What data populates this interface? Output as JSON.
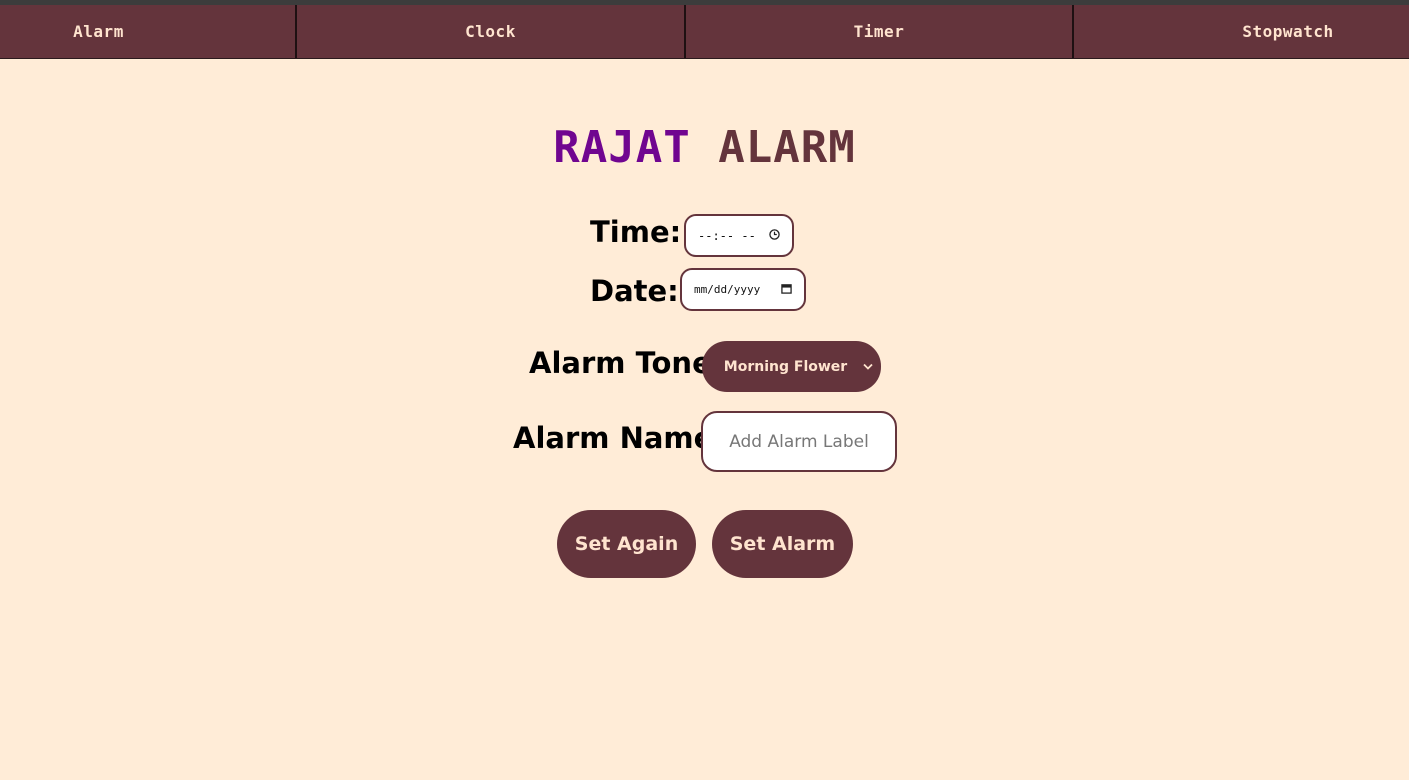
{
  "nav": {
    "items": [
      {
        "label": "Alarm"
      },
      {
        "label": "Clock"
      },
      {
        "label": "Timer"
      },
      {
        "label": "Stopwatch"
      }
    ]
  },
  "title": {
    "part1": "RAJAT",
    "part2": "ALARM"
  },
  "form": {
    "time_label": "Time:",
    "time_value": "--:-- --",
    "date_label": "Date:",
    "date_value": "mm/dd/yyyy",
    "tone_label": "Alarm Tone:",
    "tone_selected": "Morning Flower",
    "name_label": "Alarm Name:",
    "name_placeholder": "Add Alarm Label"
  },
  "buttons": {
    "set_again": "Set Again",
    "set_alarm": "Set Alarm"
  },
  "icons": {
    "time": "clock-icon",
    "date": "calendar-icon",
    "select": "chevron-down-icon"
  },
  "colors": {
    "background": "#ffecd7",
    "primary": "#64343c",
    "accent": "#700590",
    "light_text": "#ffe4cf"
  }
}
